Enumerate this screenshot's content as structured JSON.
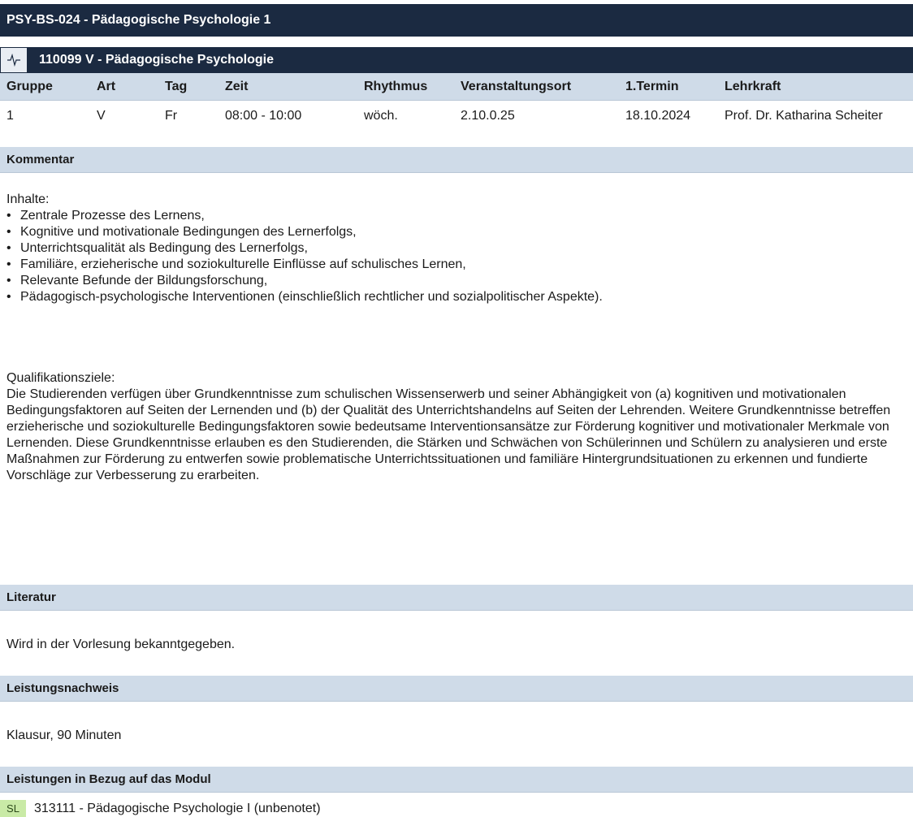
{
  "module": {
    "title": "PSY-BS-024 - Pädagogische Psychologie 1"
  },
  "course": {
    "icon": "pulse-icon",
    "title": "110099 V - Pädagogische Psychologie",
    "columns": [
      "Gruppe",
      "Art",
      "Tag",
      "Zeit",
      "Rhythmus",
      "Veranstaltungsort",
      "1.Termin",
      "Lehrkraft"
    ],
    "rows": [
      {
        "gruppe": "1",
        "art": "V",
        "tag": "Fr",
        "zeit": "08:00 - 10:00",
        "rhythmus": "wöch.",
        "ort": "2.10.0.25",
        "termin": "18.10.2024",
        "lehrkraft": "Prof. Dr. Katharina Scheiter"
      }
    ]
  },
  "kommentar": {
    "heading": "Kommentar",
    "inhalte_label": "Inhalte:",
    "inhalte": [
      "Zentrale Prozesse des Lernens,",
      "Kognitive und motivationale Bedingungen des Lernerfolgs,",
      "Unterrichtsqualität als Bedingung des Lernerfolgs,",
      "Familiäre, erzieherische und soziokulturelle Einflüsse auf schulisches Lernen,",
      "Relevante Befunde der Bildungsforschung,",
      "Pädagogisch-psychologische Interventionen (einschließlich rechtlicher und sozialpolitischer Aspekte)."
    ],
    "ziele_label": "Qualifikationsziele:",
    "ziele_text": "Die Studierenden verfügen über Grundkenntnisse zum schulischen Wissenserwerb und seiner Abhängigkeit von (a) kognitiven und motivationalen Bedingungsfaktoren auf Seiten der Lernenden und (b) der Qualität des Unterrichtshandelns auf Seiten der Lehrenden. Weitere Grundkenntnisse betreffen erzieherische und soziokulturelle Bedingungsfaktoren sowie bedeutsame Interventionsansätze zur Förderung kognitiver und motivationaler Merkmale von Lernenden. Diese Grundkenntnisse erlauben es den Studierenden, die Stärken und Schwächen von Schülerinnen und Schülern zu analysieren und erste Maßnahmen zur Förderung zu entwerfen sowie problematische Unterrichtssituationen und familiäre Hintergrundsituationen zu erkennen und fundierte Vorschläge zur Verbesserung zu erarbeiten."
  },
  "literatur": {
    "heading": "Literatur",
    "text": "Wird in der Vorlesung bekanntgegeben."
  },
  "leistungsnachweis": {
    "heading": "Leistungsnachweis",
    "text": "Klausur, 90 Minuten"
  },
  "leistungen_modul": {
    "heading": "Leistungen in Bezug auf das Modul",
    "badge": "SL",
    "badge_color": "#c9eaa6",
    "text": "313111 - Pädagogische Psychologie I (unbenotet)"
  },
  "colors": {
    "header_dark": "#1b2a41",
    "section_light": "#cfdbe8"
  }
}
